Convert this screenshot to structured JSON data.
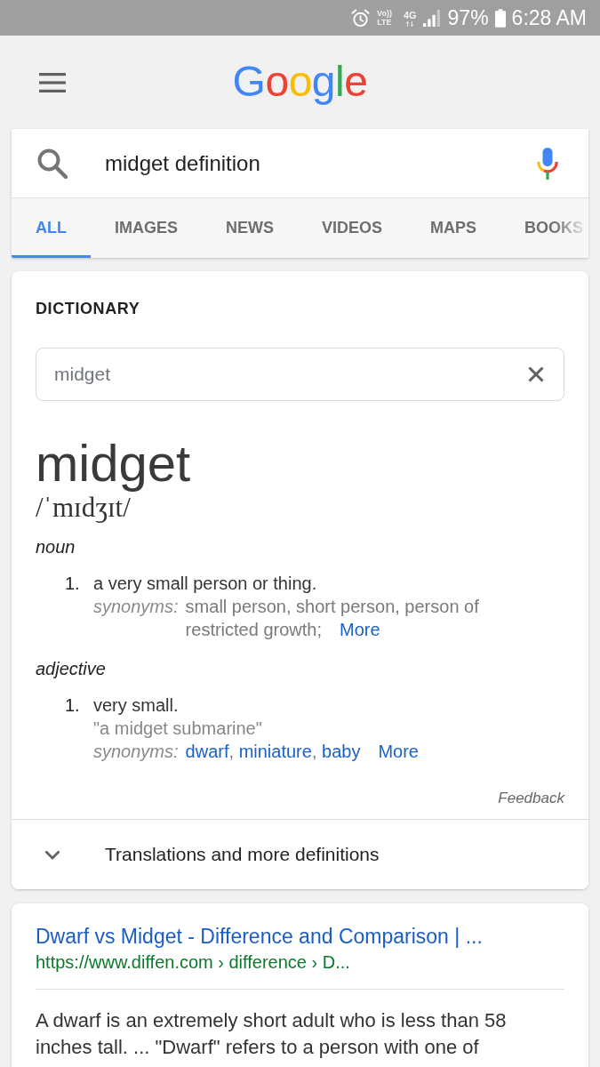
{
  "status_bar": {
    "volte": [
      "Vo))",
      "LTE"
    ],
    "network": "4G",
    "battery": "97%",
    "time": "6:28 AM"
  },
  "header": {
    "logo": "Google"
  },
  "search": {
    "value": "midget definition"
  },
  "tabs": [
    {
      "label": "ALL",
      "selected": true
    },
    {
      "label": "IMAGES",
      "selected": false
    },
    {
      "label": "NEWS",
      "selected": false
    },
    {
      "label": "VIDEOS",
      "selected": false
    },
    {
      "label": "MAPS",
      "selected": false
    },
    {
      "label": "BOOKS",
      "selected": false
    }
  ],
  "dictionary": {
    "title": "DICTIONARY",
    "field": {
      "value": "midget"
    },
    "word": "midget",
    "phonetic": "/ˈmɪdʒɪt/",
    "senses": [
      {
        "pos": "noun",
        "definitions": [
          {
            "number": "1.",
            "text": "a very small person or thing.",
            "synonyms_label": "synonyms:",
            "synonyms": [
              {
                "text": "small person, short person, person of restricted growth;",
                "link": false
              }
            ],
            "more": "More"
          }
        ]
      },
      {
        "pos": "adjective",
        "definitions": [
          {
            "number": "1.",
            "text": "very small.",
            "example": "\"a midget submarine\"",
            "synonyms_label": "synonyms:",
            "synonyms": [
              {
                "text": "dwarf",
                "link": true
              },
              {
                "text": ", ",
                "link": false
              },
              {
                "text": "miniature",
                "link": true
              },
              {
                "text": ", ",
                "link": false
              },
              {
                "text": "baby",
                "link": true
              }
            ],
            "more": "More"
          }
        ]
      }
    ],
    "feedback": "Feedback",
    "more_definitions": {
      "label": "Translations and more definitions",
      "expanded": false
    }
  },
  "results": [
    {
      "title": "Dwarf vs Midget - Difference and Comparison | ...",
      "url": "https://www.diffen.com › difference › D...",
      "snippet": "A dwarf is an extremely short adult who is less than 58 inches tall. ... \"Dwarf\" refers to a person with one of"
    }
  ]
}
